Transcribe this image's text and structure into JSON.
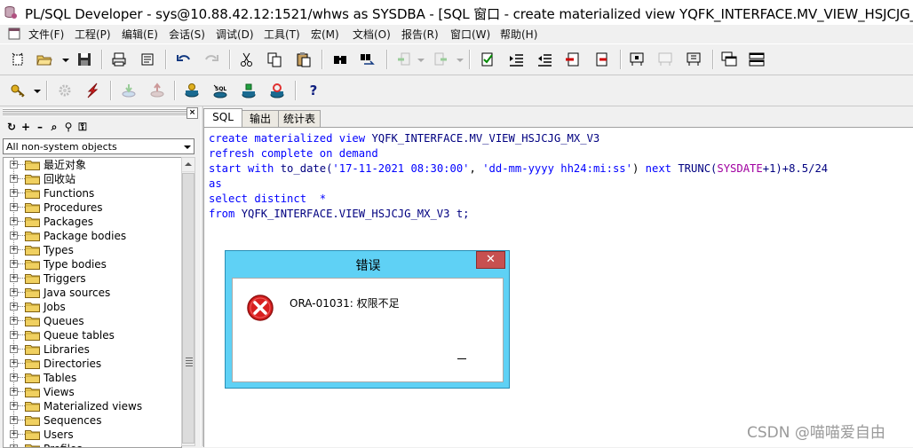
{
  "window": {
    "title": "PL/SQL Developer - sys@10.88.42.12:1521/whws as SYSDBA - [SQL 窗口 - create materialized view YQFK_INTERFACE.MV_VIEW_HSJCJG_M",
    "icon": "database-icon"
  },
  "menu": {
    "items": [
      "文件(F)",
      "工程(P)",
      "编辑(E)",
      "会话(S)",
      "调试(D)",
      "工具(T)",
      "宏(M)",
      "文档(O)",
      "报告(R)",
      "窗口(W)",
      "帮助(H)"
    ]
  },
  "toolbar1": {
    "icons": [
      "new-icon",
      "open-icon",
      "save-icon",
      "print-icon",
      "print-preview-icon",
      "undo-icon",
      "redo-icon",
      "cut-icon",
      "copy-icon",
      "paste-icon",
      "find-icon",
      "find-replace-icon",
      "back-icon",
      "forward-icon",
      "execute-check-icon",
      "indent-icon",
      "unindent-icon",
      "comment-icon",
      "uncomment-icon",
      "query-by-example-icon",
      "clear-icon",
      "selection-icon",
      "cascade-icon",
      "tile-icon"
    ]
  },
  "toolbar2": {
    "icons": [
      "key-icon",
      "gear-icon",
      "lightning-icon",
      "commit-icon",
      "rollback-icon",
      "execute-icon",
      "sql-icon",
      "stop-icon",
      "refresh-icon",
      "help-icon"
    ],
    "help_label": "?"
  },
  "browser": {
    "tools": [
      "↻",
      "+",
      "–",
      "⌕",
      "⚲",
      "⚿"
    ],
    "filter": "All non-system objects",
    "items": [
      {
        "label": "最近对象"
      },
      {
        "label": "回收站"
      },
      {
        "label": "Functions"
      },
      {
        "label": "Procedures"
      },
      {
        "label": "Packages"
      },
      {
        "label": "Package bodies"
      },
      {
        "label": "Types"
      },
      {
        "label": "Type bodies"
      },
      {
        "label": "Triggers"
      },
      {
        "label": "Java sources"
      },
      {
        "label": "Jobs"
      },
      {
        "label": "Queues"
      },
      {
        "label": "Queue tables"
      },
      {
        "label": "Libraries"
      },
      {
        "label": "Directories"
      },
      {
        "label": "Tables"
      },
      {
        "label": "Views"
      },
      {
        "label": "Materialized views"
      },
      {
        "label": "Sequences"
      },
      {
        "label": "Users"
      },
      {
        "label": "Profiles"
      }
    ]
  },
  "editor": {
    "tabs": [
      "SQL",
      "输出",
      "统计表"
    ],
    "code": {
      "l1_kw": "create materialized view ",
      "l1_id": "YQFK_INTERFACE.MV_VIEW_HSJCJG_MX_V3",
      "l2": "refresh complete on demand",
      "l3_kw1": "start with ",
      "l3_fn": "to_date(",
      "l3_s1": "'17-11-2021 08:30:00'",
      "l3_c": ", ",
      "l3_s2": "'dd-mm-yyyy hh24:mi:ss'",
      "l3_p": ") ",
      "l3_kw2": "next ",
      "l3_fn2": "TRUNC(",
      "l3_sys": "SYSDATE",
      "l3_rest": "+1)+8.5/24",
      "l4": "as",
      "l5": "select distinct  *",
      "l6_kw": "from ",
      "l6_id": "YQFK_INTERFACE.VIEW_HSJCJG_MX_V3 t;"
    }
  },
  "dialog": {
    "title": "错误",
    "close": "✕",
    "message": "ORA-01031: 权限不足",
    "icon": "error-icon"
  },
  "watermark": "CSDN @喵喵爱自由"
}
